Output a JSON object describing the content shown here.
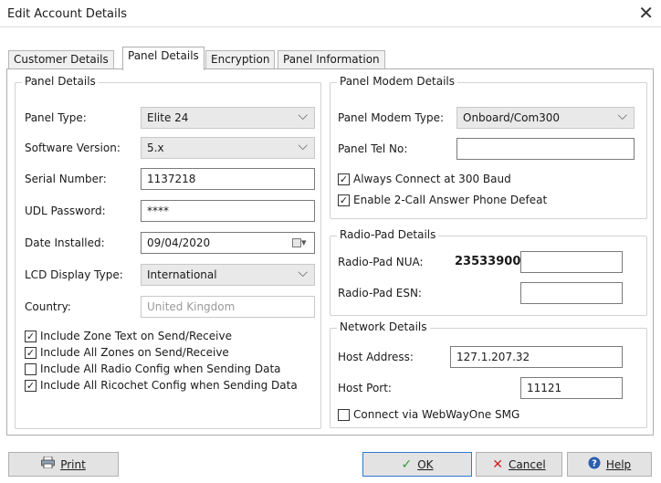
{
  "window": {
    "title": "Edit Account Details",
    "close_glyph": "✕"
  },
  "tabs": [
    {
      "label": "Customer Details",
      "active": false
    },
    {
      "label": "Panel Details",
      "active": true
    },
    {
      "label": "Encryption",
      "active": false
    },
    {
      "label": "Panel Information",
      "active": false
    }
  ],
  "panel_details": {
    "legend": "Panel Details",
    "panel_type": {
      "label": "Panel Type:",
      "value": "Elite 24"
    },
    "software_version": {
      "label": "Software Version:",
      "value": "5.x"
    },
    "serial_number": {
      "label": "Serial Number:",
      "value": "1137218"
    },
    "udl_password": {
      "label": "UDL Password:",
      "value": "****"
    },
    "date_installed": {
      "label": "Date Installed:",
      "value": "09/04/2020"
    },
    "lcd_display_type": {
      "label": "LCD Display Type:",
      "value": "International"
    },
    "country": {
      "label": "Country:",
      "value": "United Kingdom"
    },
    "checkboxes": [
      {
        "label": "Include Zone Text on Send/Receive",
        "checked": true
      },
      {
        "label": "Include All Zones on Send/Receive",
        "checked": true
      },
      {
        "label": "Include All Radio Config when Sending Data",
        "checked": false
      },
      {
        "label": "Include All Ricochet Config when Sending Data",
        "checked": true
      }
    ]
  },
  "panel_modem": {
    "legend": "Panel Modem Details",
    "modem_type": {
      "label": "Panel Modem Type:",
      "value": "Onboard/Com300"
    },
    "tel_no": {
      "label": "Panel Tel No:",
      "value": ""
    },
    "checkboxes": [
      {
        "label": "Always Connect at 300 Baud",
        "checked": true
      },
      {
        "label": "Enable 2-Call Answer Phone Defeat",
        "checked": true
      }
    ]
  },
  "radio_pad": {
    "legend": "Radio-Pad Details",
    "nua": {
      "label": "Radio-Pad NUA:",
      "prefix": "23533900",
      "value": ""
    },
    "esn": {
      "label": "Radio-Pad ESN:",
      "value": ""
    }
  },
  "network": {
    "legend": "Network Details",
    "host_address": {
      "label": "Host Address:",
      "value": "127.1.207.32"
    },
    "host_port": {
      "label": "Host Port:",
      "value": "11121"
    },
    "webwayone": {
      "label": "Connect via WebWayOne SMG",
      "checked": false
    }
  },
  "buttons": {
    "print": {
      "label": "Print",
      "icon": "printer-icon"
    },
    "ok": {
      "label": "OK",
      "icon": "checkmark-icon"
    },
    "cancel": {
      "label": "Cancel",
      "icon": "cross-icon"
    },
    "help": {
      "label": "Help",
      "icon": "help-icon"
    }
  },
  "colors": {
    "ok_check": "#2e9e2e",
    "cancel_x": "#d02020",
    "help_blue": "#2a5db0",
    "ok_border": "#2e7ad1"
  }
}
